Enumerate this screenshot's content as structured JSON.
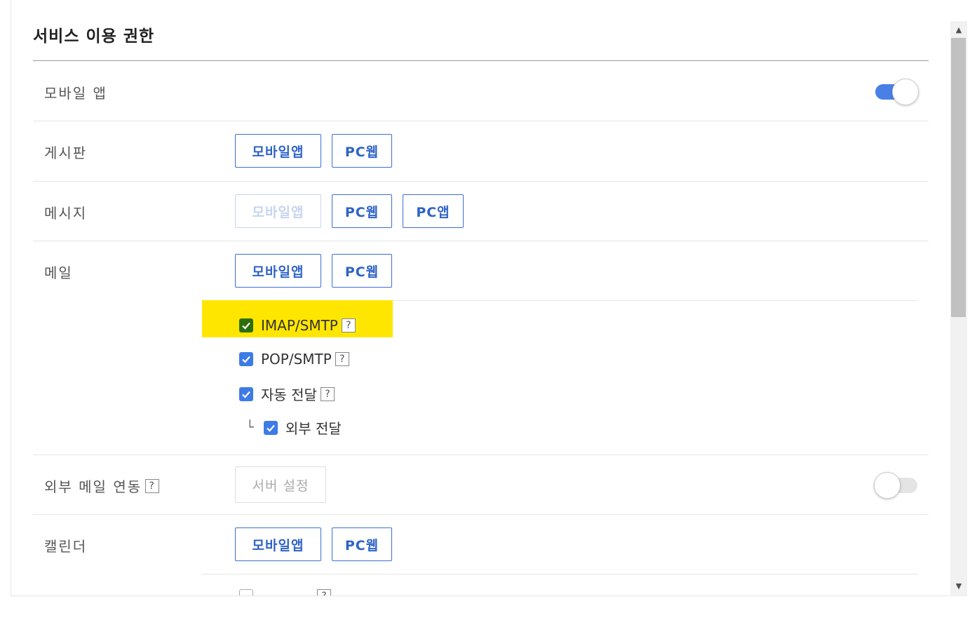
{
  "page": {
    "title": "서비스 이용 권한"
  },
  "rows": {
    "mobile_app": {
      "label": "모바일 앱",
      "toggle_on": true
    },
    "board": {
      "label": "게시판",
      "buttons": [
        "모바일앱",
        "PC웹"
      ]
    },
    "messenger": {
      "label": "메시지",
      "buttons": [
        "모바일앱",
        "PC웹",
        "PC앱"
      ]
    },
    "mail": {
      "label": "메일",
      "buttons": [
        "모바일앱",
        "PC웹"
      ],
      "options": [
        {
          "label": "IMAP/SMTP",
          "help": "?",
          "checked": true
        },
        {
          "label": "POP/SMTP",
          "help": "?",
          "checked": true
        },
        {
          "label": "자동 전달",
          "help": "?",
          "checked": true
        },
        {
          "label": "외부 전달",
          "prefix": "└",
          "checked": true
        }
      ]
    },
    "external_mail": {
      "label": "외부 메일 연동",
      "help": "?",
      "button": "서버 설정",
      "toggle_on": false
    },
    "calendar": {
      "label": "캘린더",
      "buttons": [
        "모바일앱",
        "PC웹"
      ],
      "option_help": "?"
    }
  },
  "colors": {
    "accent": "#3d7be6",
    "button_text": "#2f63c7",
    "highlight": "#ffe600"
  },
  "icons": {
    "check": "check-icon",
    "scroll_up": "scroll-up-arrow-icon",
    "scroll_down": "scroll-down-arrow-icon"
  }
}
